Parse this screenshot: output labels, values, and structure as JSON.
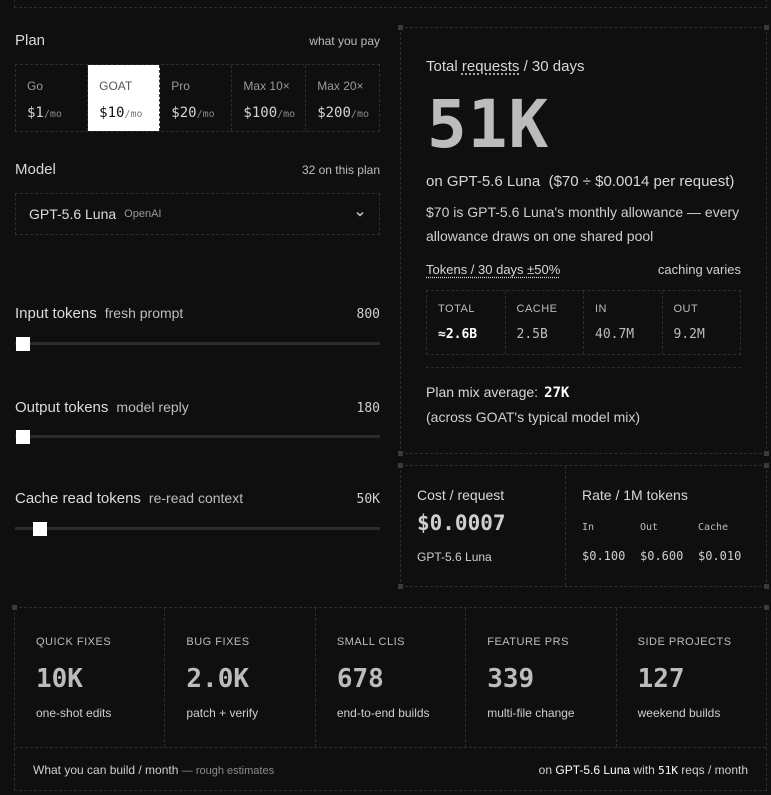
{
  "plan": {
    "label": "Plan",
    "sublabel": "what you pay",
    "options": [
      {
        "name": "Go",
        "price": "$1",
        "per": "/mo"
      },
      {
        "name": "GOAT",
        "price": "$10",
        "per": "/mo"
      },
      {
        "name": "Pro",
        "price": "$20",
        "per": "/mo"
      },
      {
        "name": "Max 10×",
        "price": "$100",
        "per": "/mo"
      },
      {
        "name": "Max 20×",
        "price": "$200",
        "per": "/mo"
      }
    ],
    "selected": "GOAT"
  },
  "model": {
    "label": "Model",
    "sublabel": "32 on this plan",
    "selected_name": "GPT-5.6 Luna",
    "selected_provider": "OpenAI",
    "icon": "chevron-down-icon"
  },
  "sliders": {
    "input": {
      "name": "Input tokens",
      "sub": "fresh prompt",
      "value": "800",
      "level": 0.0
    },
    "output": {
      "name": "Output tokens",
      "sub": "model reply",
      "value": "180",
      "level": 0.0
    },
    "cache": {
      "name": "Cache read tokens",
      "sub": "re-read context",
      "value": "50K",
      "level": 0.05
    }
  },
  "summary": {
    "title_pre": "Total ",
    "title_u": "requests",
    "title_post": " / 30 days",
    "big": "51K",
    "on_line": "on GPT-5.6 Luna  ($70 ÷ $0.0014 per request)",
    "note": "$70 is GPT-5.6 Luna's monthly allowance — every allowance draws on one shared pool",
    "tokens_head": "Tokens / 30 days ±50%",
    "tokens_note": "caching varies",
    "tokens": [
      {
        "head": "TOTAL",
        "val": "≈2.6B"
      },
      {
        "head": "CACHE",
        "val": "2.5B"
      },
      {
        "head": "IN",
        "val": "40.7M"
      },
      {
        "head": "OUT",
        "val": "9.2M"
      }
    ],
    "mix_label": "Plan mix average:",
    "mix_value": "27K",
    "mix_note": "(across GOAT's typical model mix)"
  },
  "cost": {
    "title": "Cost / request",
    "value": "$0.0007",
    "model": "GPT-5.6 Luna",
    "rate_title": "Rate / 1M tokens",
    "rates": [
      {
        "head": "In",
        "val": "$0.100"
      },
      {
        "head": "Out",
        "val": "$0.600"
      },
      {
        "head": "Cache",
        "val": "$0.010"
      }
    ]
  },
  "builds": {
    "items": [
      {
        "head": "QUICK FIXES",
        "val": "10K",
        "sub": "one-shot edits"
      },
      {
        "head": "BUG FIXES",
        "val": "2.0K",
        "sub": "patch + verify"
      },
      {
        "head": "SMALL CLIS",
        "val": "678",
        "sub": "end-to-end builds"
      },
      {
        "head": "FEATURE PRS",
        "val": "339",
        "sub": "multi-file change"
      },
      {
        "head": "SIDE PROJECTS",
        "val": "127",
        "sub": "weekend builds"
      }
    ],
    "footer_left": "What you can build / month",
    "footer_rough": "— rough estimates",
    "footer_on": "on ",
    "footer_model": "GPT-5.6 Luna",
    "footer_with": " with ",
    "footer_reqs": "51K",
    "footer_tail": " reqs / month"
  }
}
